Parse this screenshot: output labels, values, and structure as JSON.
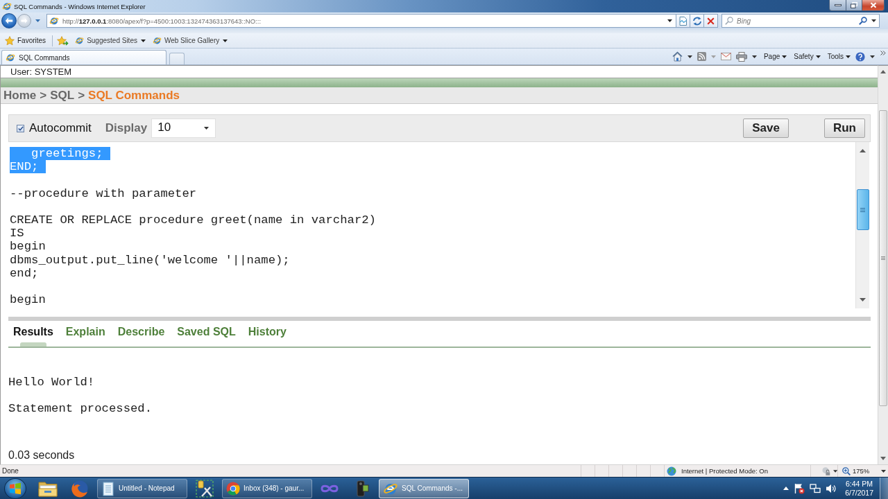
{
  "window": {
    "title": "SQL Commands - Windows Internet Explorer"
  },
  "navigation": {
    "back": {
      "disabled": false
    },
    "forward": {
      "disabled": true
    }
  },
  "address_bar": {
    "url": "http://**127.0.0.1**:8080/apex/f?p=4500:1003:132474363137643::NO:::"
  },
  "search": {
    "placeholder": "Bing"
  },
  "favorites_bar": {
    "label": "Favorites",
    "items": [
      "Suggested Sites",
      "Web Slice Gallery"
    ]
  },
  "tabs": [
    {
      "label": "SQL Commands",
      "selected": true
    }
  ],
  "command_bar": {
    "menus": [
      "Page",
      "Safety",
      "Tools"
    ]
  },
  "page": {
    "user": "User: SYSTEM",
    "breadcrumb": [
      {
        "kind": "link",
        "label": "Home"
      },
      {
        "kind": "separator",
        "label": ">"
      },
      {
        "kind": "link",
        "label": "SQL"
      },
      {
        "kind": "separator",
        "label": ">"
      },
      {
        "kind": "current",
        "label": "SQL Commands"
      }
    ],
    "toolbar": {
      "autocommit": {
        "label": "Autocommit",
        "checked": true
      },
      "display": {
        "label": "Display",
        "value": "10"
      },
      "buttons": [
        "Save",
        "Run"
      ]
    },
    "editor": {
      "lines": [
        {
          "kind": "code",
          "text": "   greetings;",
          "selected": true
        },
        {
          "kind": "code",
          "text": "END;",
          "selected": true
        },
        {
          "kind": "blank",
          "selected": false
        },
        {
          "kind": "code",
          "text": "--procedure with parameter",
          "selected": false
        },
        {
          "kind": "blank",
          "selected": false
        },
        {
          "kind": "code",
          "text": "CREATE OR REPLACE procedure greet(name in varchar2)",
          "selected": false
        },
        {
          "kind": "code",
          "text": "IS",
          "selected": false
        },
        {
          "kind": "code",
          "text": "begin",
          "selected": false
        },
        {
          "kind": "code",
          "text": "dbms_output.put_line('welcome '||name);",
          "selected": false
        },
        {
          "kind": "code",
          "text": "end;",
          "selected": false
        },
        {
          "kind": "blank",
          "selected": false
        },
        {
          "kind": "code",
          "text": "begin",
          "selected": false
        }
      ]
    },
    "result_tabs": [
      {
        "label": "Results",
        "selected": true
      },
      {
        "label": "Explain",
        "selected": false
      },
      {
        "label": "Describe",
        "selected": false
      },
      {
        "label": "Saved SQL",
        "selected": false
      },
      {
        "label": "History",
        "selected": false
      }
    ],
    "output": {
      "lines": [
        "Hello World!",
        "Statement processed."
      ],
      "timing": "0.03 seconds"
    }
  },
  "status_bar": {
    "text": "Done",
    "zone": "Internet | Protected Mode: On",
    "zoom": "175%"
  },
  "taskbar": {
    "windows": [
      {
        "label": "Untitled - Notepad",
        "active": false
      },
      {
        "label": "Inbox (348) - gaur...",
        "active": false
      },
      {
        "label": "SQL Commands -...",
        "active": true
      }
    ],
    "clock": {
      "time": "6:44 PM",
      "date": "6/7/2017"
    }
  }
}
